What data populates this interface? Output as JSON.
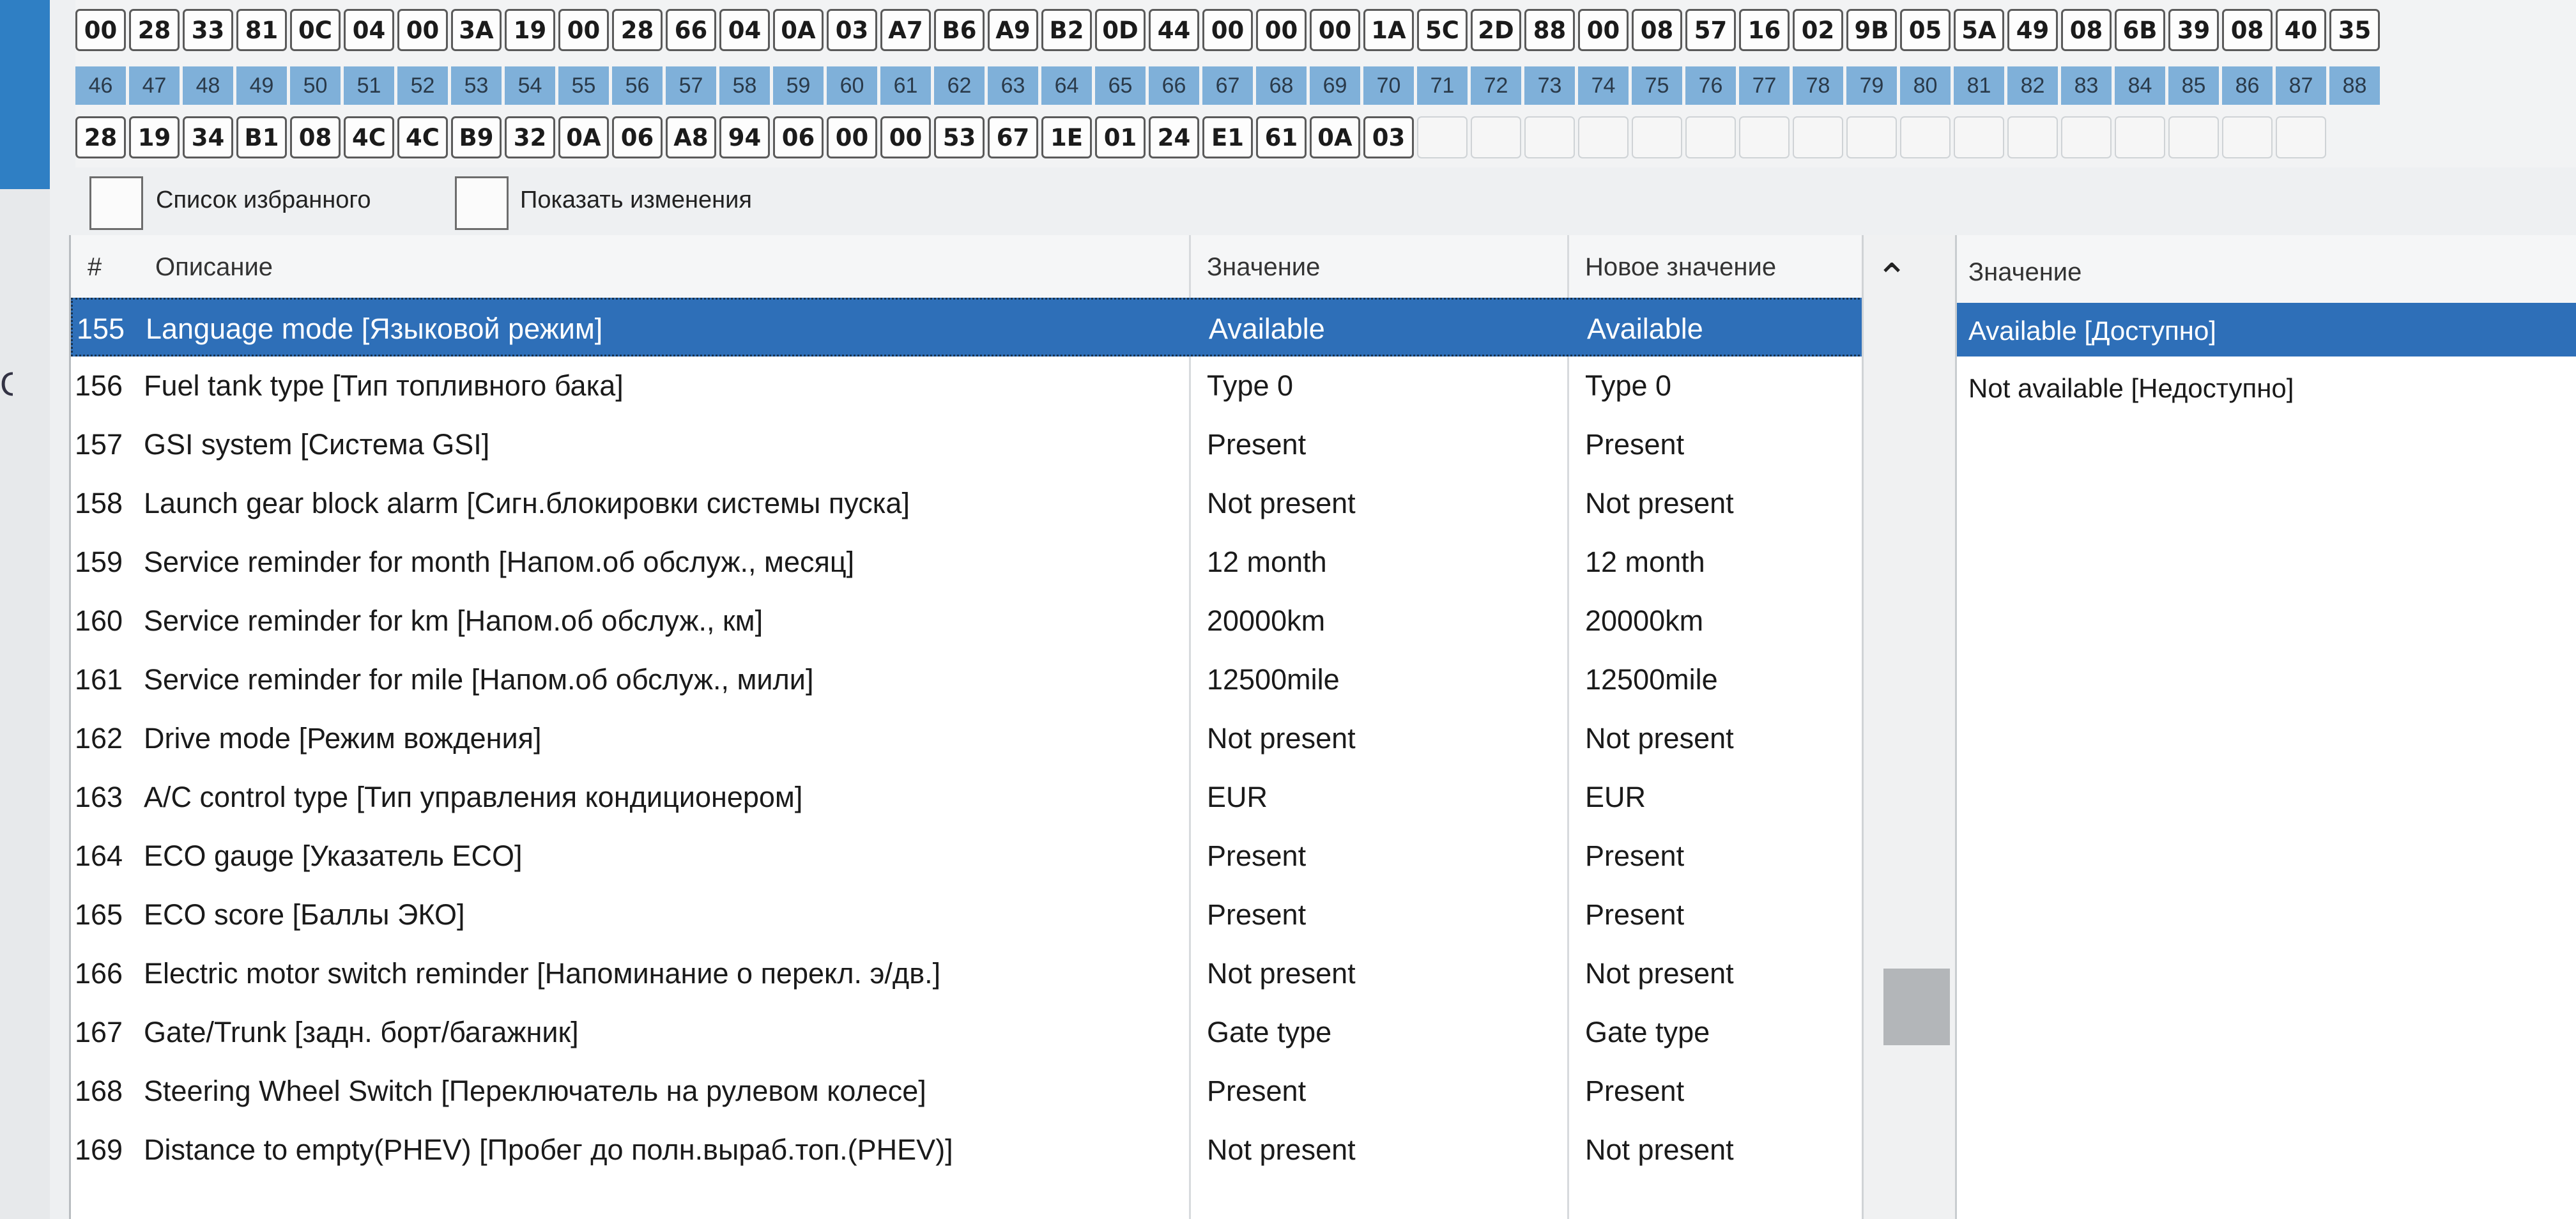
{
  "hex_bytes": {
    "row1": [
      "00",
      "28",
      "33",
      "81",
      "0C",
      "04",
      "00",
      "3A",
      "19",
      "00",
      "28",
      "66",
      "04",
      "0A",
      "03",
      "A7",
      "B6",
      "A9",
      "B2",
      "0D",
      "44",
      "00",
      "00",
      "00",
      "1A",
      "5C",
      "2D",
      "88",
      "00",
      "08",
      "57",
      "16",
      "02",
      "9B",
      "05",
      "5A",
      "49",
      "08",
      "6B",
      "39",
      "08",
      "40",
      "35"
    ],
    "row2_indices": [
      "46",
      "47",
      "48",
      "49",
      "50",
      "51",
      "52",
      "53",
      "54",
      "55",
      "56",
      "57",
      "58",
      "59",
      "60",
      "61",
      "62",
      "63",
      "64",
      "65",
      "66",
      "67",
      "68",
      "69",
      "70",
      "71",
      "72",
      "73",
      "74",
      "75",
      "76",
      "77",
      "78",
      "79",
      "80",
      "81",
      "82",
      "83",
      "84",
      "85",
      "86",
      "87",
      "88"
    ],
    "row3": [
      "28",
      "19",
      "34",
      "B1",
      "08",
      "4C",
      "4C",
      "B9",
      "32",
      "0A",
      "06",
      "A8",
      "94",
      "06",
      "00",
      "00",
      "53",
      "67",
      "1E",
      "01",
      "24",
      "E1",
      "61",
      "0A",
      "03"
    ],
    "row3_empty_count": 17
  },
  "options": {
    "favorites_label": "Список избранного",
    "show_changes_label": "Показать изменения"
  },
  "table": {
    "headers": {
      "num": "#",
      "description": "Описание",
      "value": "Значение",
      "new_value": "Новое значение"
    },
    "selected_index": 0,
    "rows": [
      {
        "num": "155",
        "description": "Language mode  [Языковой режим]",
        "value": "Available",
        "new_value": "Available"
      },
      {
        "num": "156",
        "description": "Fuel tank type  [Тип топливного бака]",
        "value": "Type 0",
        "new_value": "Type 0"
      },
      {
        "num": "157",
        "description": "GSI system  [Система GSI]",
        "value": "Present",
        "new_value": "Present"
      },
      {
        "num": "158",
        "description": "Launch gear block alarm  [Сигн.блокировки системы пуска]",
        "value": "Not present",
        "new_value": "Not present"
      },
      {
        "num": "159",
        "description": "Service reminder for month  [Напом.об обслуж., месяц]",
        "value": "12 month",
        "new_value": "12 month"
      },
      {
        "num": "160",
        "description": "Service reminder for km  [Напом.об обслуж., км]",
        "value": "20000km",
        "new_value": "20000km"
      },
      {
        "num": "161",
        "description": "Service reminder for mile  [Напом.об обслуж., мили]",
        "value": "12500mile",
        "new_value": "12500mile"
      },
      {
        "num": "162",
        "description": "Drive mode  [Режим вождения]",
        "value": "Not present",
        "new_value": "Not present"
      },
      {
        "num": "163",
        "description": "A/C control type  [Тип управления кондиционером]",
        "value": "EUR",
        "new_value": "EUR"
      },
      {
        "num": "164",
        "description": "ECO gauge  [Указатель ECO]",
        "value": "Present",
        "new_value": "Present"
      },
      {
        "num": "165",
        "description": "ECO score  [Баллы ЭКО]",
        "value": "Present",
        "new_value": "Present"
      },
      {
        "num": "166",
        "description": "Electric motor switch reminder  [Напоминание о перекл. э/дв.]",
        "value": "Not present",
        "new_value": "Not present"
      },
      {
        "num": "167",
        "description": "Gate/Trunk  [задн. борт/багажник]",
        "value": "Gate type",
        "new_value": "Gate type"
      },
      {
        "num": "168",
        "description": "Steering Wheel Switch  [Переключатель на рулевом колесе]",
        "value": "Present",
        "new_value": "Present"
      },
      {
        "num": "169",
        "description": "Distance to empty(PHEV)  [Пробег до полн.выраб.топ.(PHEV)]",
        "value": "Not present",
        "new_value": "Not present"
      }
    ]
  },
  "value_panel": {
    "header": "Значение",
    "options": [
      "Available  [Доступно]",
      "Not available  [Недоступно]"
    ],
    "selected_index": 0
  },
  "colors": {
    "selection": "#2e6fb8",
    "index_strip": "#7fb0d9",
    "window_accent": "#2f7fc4"
  },
  "icons": {
    "scroll_up": "chevron-up-icon",
    "left_edge_fragment": "C"
  }
}
